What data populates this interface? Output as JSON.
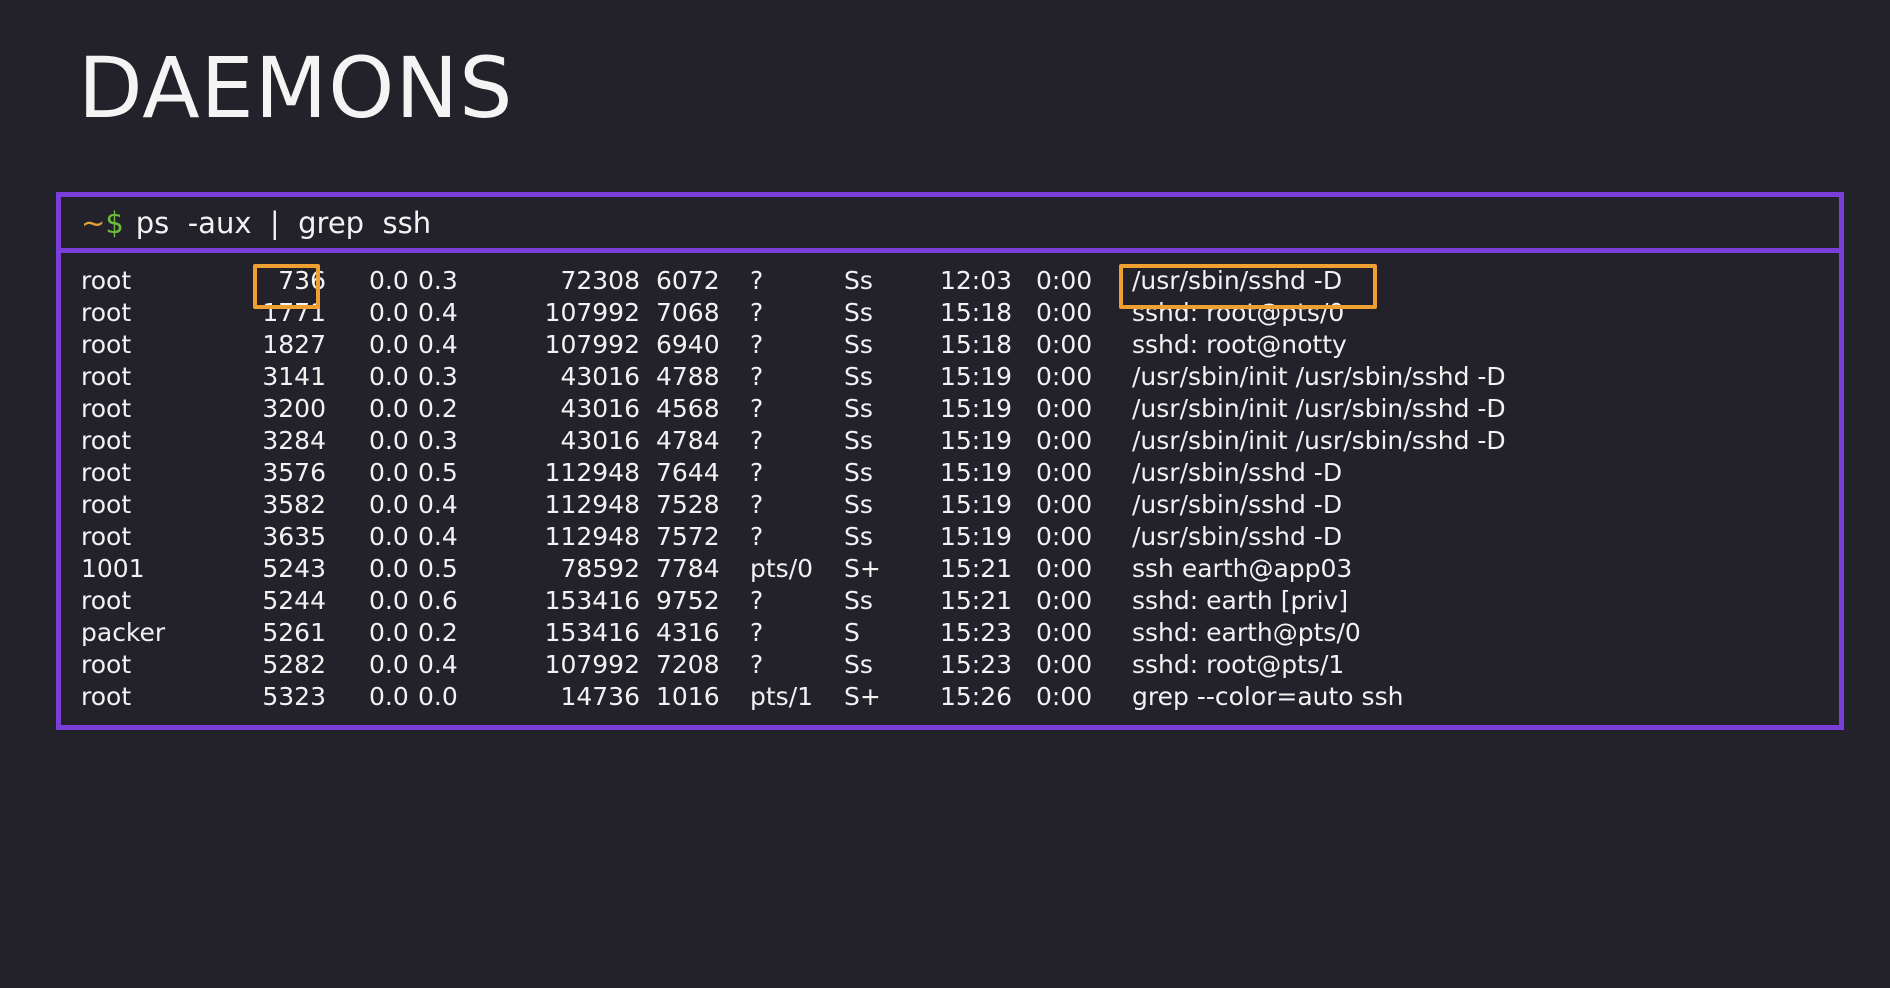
{
  "title": "DAEMONS",
  "terminal": {
    "prompt_tilde": "~",
    "prompt_dollar": "$",
    "command": "ps  -aux  |  grep  ssh"
  },
  "processes": [
    {
      "user": "root",
      "pid": "736",
      "cpu": "0.0",
      "mem": "0.3",
      "vsz": "72308",
      "rss": "6072",
      "tty": "?",
      "stat": "Ss",
      "start": "12:03",
      "time": "0:00",
      "command": "/usr/sbin/sshd -D"
    },
    {
      "user": "root",
      "pid": "1771",
      "cpu": "0.0",
      "mem": "0.4",
      "vsz": "107992",
      "rss": "7068",
      "tty": "?",
      "stat": "Ss",
      "start": "15:18",
      "time": "0:00",
      "command": "sshd: root@pts/0"
    },
    {
      "user": "root",
      "pid": "1827",
      "cpu": "0.0",
      "mem": "0.4",
      "vsz": "107992",
      "rss": "6940",
      "tty": "?",
      "stat": "Ss",
      "start": "15:18",
      "time": "0:00",
      "command": "sshd: root@notty"
    },
    {
      "user": "root",
      "pid": "3141",
      "cpu": "0.0",
      "mem": "0.3",
      "vsz": "43016",
      "rss": "4788",
      "tty": "?",
      "stat": "Ss",
      "start": "15:19",
      "time": "0:00",
      "command": "/usr/sbin/init /usr/sbin/sshd -D"
    },
    {
      "user": "root",
      "pid": "3200",
      "cpu": "0.0",
      "mem": "0.2",
      "vsz": "43016",
      "rss": "4568",
      "tty": "?",
      "stat": "Ss",
      "start": "15:19",
      "time": "0:00",
      "command": "/usr/sbin/init /usr/sbin/sshd -D"
    },
    {
      "user": "root",
      "pid": "3284",
      "cpu": "0.0",
      "mem": "0.3",
      "vsz": "43016",
      "rss": "4784",
      "tty": "?",
      "stat": "Ss",
      "start": "15:19",
      "time": "0:00",
      "command": "/usr/sbin/init /usr/sbin/sshd -D"
    },
    {
      "user": "root",
      "pid": "3576",
      "cpu": "0.0",
      "mem": "0.5",
      "vsz": "112948",
      "rss": "7644",
      "tty": "?",
      "stat": "Ss",
      "start": "15:19",
      "time": "0:00",
      "command": "/usr/sbin/sshd -D"
    },
    {
      "user": "root",
      "pid": "3582",
      "cpu": "0.0",
      "mem": "0.4",
      "vsz": "112948",
      "rss": "7528",
      "tty": "?",
      "stat": "Ss",
      "start": "15:19",
      "time": "0:00",
      "command": "/usr/sbin/sshd -D"
    },
    {
      "user": "root",
      "pid": "3635",
      "cpu": "0.0",
      "mem": "0.4",
      "vsz": "112948",
      "rss": "7572",
      "tty": "?",
      "stat": "Ss",
      "start": "15:19",
      "time": "0:00",
      "command": "/usr/sbin/sshd -D"
    },
    {
      "user": "1001",
      "pid": "5243",
      "cpu": "0.0",
      "mem": "0.5",
      "vsz": "78592",
      "rss": "7784",
      "tty": "pts/0",
      "stat": "S+",
      "start": "15:21",
      "time": "0:00",
      "command": "ssh earth@app03"
    },
    {
      "user": "root",
      "pid": "5244",
      "cpu": "0.0",
      "mem": "0.6",
      "vsz": "153416",
      "rss": "9752",
      "tty": "?",
      "stat": "Ss",
      "start": "15:21",
      "time": "0:00",
      "command": "sshd: earth [priv]"
    },
    {
      "user": "packer",
      "pid": "5261",
      "cpu": "0.0",
      "mem": "0.2",
      "vsz": "153416",
      "rss": "4316",
      "tty": "?",
      "stat": "S",
      "start": "15:23",
      "time": "0:00",
      "command": "sshd: earth@pts/0"
    },
    {
      "user": "root",
      "pid": "5282",
      "cpu": "0.0",
      "mem": "0.4",
      "vsz": "107992",
      "rss": "7208",
      "tty": "?",
      "stat": "Ss",
      "start": "15:23",
      "time": "0:00",
      "command": "sshd: root@pts/1"
    },
    {
      "user": "root",
      "pid": "5323",
      "cpu": "0.0",
      "mem": "0.0",
      "vsz": "14736",
      "rss": "1016",
      "tty": "pts/1",
      "stat": "S+",
      "start": "15:26",
      "time": "0:00",
      "command": "grep --color=auto ssh"
    }
  ],
  "colors": {
    "background": "#232129",
    "terminal_border": "#7b3fd9",
    "highlight": "#f0a030",
    "prompt_tilde": "#e0a03a",
    "prompt_dollar": "#6dbb3c"
  }
}
